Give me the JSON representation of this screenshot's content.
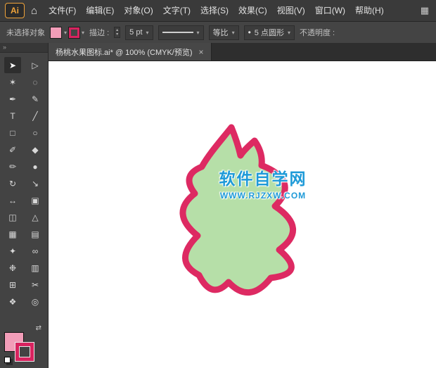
{
  "menubar": {
    "logo": "Ai",
    "items": [
      "文件(F)",
      "编辑(E)",
      "对象(O)",
      "文字(T)",
      "选择(S)",
      "效果(C)",
      "视图(V)",
      "窗口(W)",
      "帮助(H)"
    ]
  },
  "controlbar": {
    "selection_status": "未选择对象",
    "stroke_label": "描边 :",
    "stroke_width": "5 pt",
    "profile_name": "等比",
    "brush_name": "5 点圆形",
    "opacity_label": "不透明度 :",
    "fill_color": "#f29db8",
    "stroke_color": "#d8235f"
  },
  "tab": {
    "title": "杨桃水果图标.ai* @ 100% (CMYK/预览)"
  },
  "toolbar": {
    "tools": [
      {
        "name": "selection-tool",
        "glyph": "➤"
      },
      {
        "name": "direct-selection-tool",
        "glyph": "▷"
      },
      {
        "name": "magic-wand-tool",
        "glyph": "✶"
      },
      {
        "name": "lasso-tool",
        "glyph": "◌"
      },
      {
        "name": "pen-tool",
        "glyph": "✒"
      },
      {
        "name": "curvature-tool",
        "glyph": "✎"
      },
      {
        "name": "type-tool",
        "glyph": "T"
      },
      {
        "name": "line-segment-tool",
        "glyph": "╱"
      },
      {
        "name": "rectangle-tool",
        "glyph": "□"
      },
      {
        "name": "ellipse-tool",
        "glyph": "○"
      },
      {
        "name": "paintbrush-tool",
        "glyph": "✐"
      },
      {
        "name": "eraser-tool",
        "glyph": "◆"
      },
      {
        "name": "pencil-tool",
        "glyph": "✏"
      },
      {
        "name": "blob-brush-tool",
        "glyph": "●"
      },
      {
        "name": "rotate-tool",
        "glyph": "↻"
      },
      {
        "name": "scale-tool",
        "glyph": "↘"
      },
      {
        "name": "width-tool",
        "glyph": "↔"
      },
      {
        "name": "free-transform-tool",
        "glyph": "▣"
      },
      {
        "name": "shape-builder-tool",
        "glyph": "◫"
      },
      {
        "name": "perspective-grid-tool",
        "glyph": "△"
      },
      {
        "name": "mesh-tool",
        "glyph": "▦"
      },
      {
        "name": "gradient-tool",
        "glyph": "▤"
      },
      {
        "name": "eyedropper-tool",
        "glyph": "✦"
      },
      {
        "name": "blend-tool",
        "glyph": "∞"
      },
      {
        "name": "symbol-sprayer-tool",
        "glyph": "❉"
      },
      {
        "name": "column-graph-tool",
        "glyph": "▥"
      },
      {
        "name": "artboard-tool",
        "glyph": "⊞"
      },
      {
        "name": "slice-tool",
        "glyph": "✂"
      },
      {
        "name": "hand-tool",
        "glyph": "❖"
      },
      {
        "name": "zoom-tool",
        "glyph": "◎"
      }
    ]
  },
  "swatches": {
    "fill": "#f29db8",
    "stroke": "#d8235f"
  },
  "canvas": {
    "shape": {
      "fill": "#b6dfa8",
      "stroke": "#dd2a62",
      "stroke_width": "9"
    },
    "watermark": {
      "line1": "软件自学网",
      "line2": "WWW.RJZXW.COM",
      "color": "#1e9ad8"
    }
  },
  "icons": {
    "home": "⌂",
    "workspace_switcher": "▦",
    "dropdown_arrow": "▾",
    "step_up": "▴",
    "step_down": "▾",
    "bullet": "•",
    "swap": "⇄",
    "collapse": "»",
    "close": "×"
  }
}
